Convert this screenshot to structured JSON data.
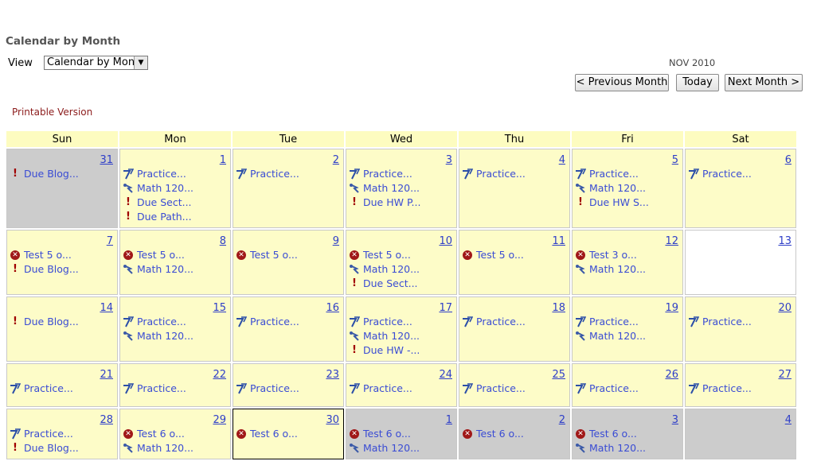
{
  "header": {
    "title": "Calendar by Month",
    "view_label": "View",
    "view_value": "Calendar by Month",
    "month_label": "NOV 2010",
    "prev_label": "< Previous Month",
    "today_label": "Today",
    "next_label": "Next Month >",
    "printable_label": "Printable Version"
  },
  "icons": {
    "due": "exclamation-icon",
    "practice": "pen-icon",
    "math": "pencil-icon",
    "test": "x-circle-icon"
  },
  "colors": {
    "cell_bg": "#fdfcc8",
    "other_month_bg": "#cccccc",
    "link": "#3a4cd4",
    "printable": "#8b1a1a"
  },
  "calendar": {
    "days": [
      "Sun",
      "Mon",
      "Tue",
      "Wed",
      "Thu",
      "Fri",
      "Sat"
    ],
    "weeks": [
      [
        {
          "day": "31",
          "other": true,
          "events": [
            {
              "type": "due",
              "label": "Due Blog..."
            }
          ]
        },
        {
          "day": "1",
          "events": [
            {
              "type": "practice",
              "label": "Practice..."
            },
            {
              "type": "math",
              "label": "Math 120..."
            },
            {
              "type": "due",
              "label": "Due Sect..."
            },
            {
              "type": "due",
              "label": "Due Path..."
            }
          ]
        },
        {
          "day": "2",
          "events": [
            {
              "type": "practice",
              "label": "Practice..."
            }
          ]
        },
        {
          "day": "3",
          "events": [
            {
              "type": "practice",
              "label": "Practice..."
            },
            {
              "type": "math",
              "label": "Math 120..."
            },
            {
              "type": "due",
              "label": "Due HW P..."
            }
          ]
        },
        {
          "day": "4",
          "events": [
            {
              "type": "practice",
              "label": "Practice..."
            }
          ]
        },
        {
          "day": "5",
          "events": [
            {
              "type": "practice",
              "label": "Practice..."
            },
            {
              "type": "math",
              "label": "Math 120..."
            },
            {
              "type": "due",
              "label": "Due HW S..."
            }
          ]
        },
        {
          "day": "6",
          "events": [
            {
              "type": "practice",
              "label": "Practice..."
            }
          ]
        }
      ],
      [
        {
          "day": "7",
          "events": [
            {
              "type": "test",
              "label": "Test 5 o..."
            },
            {
              "type": "due",
              "label": "Due Blog..."
            }
          ]
        },
        {
          "day": "8",
          "events": [
            {
              "type": "test",
              "label": "Test 5 o..."
            },
            {
              "type": "math",
              "label": "Math 120..."
            }
          ]
        },
        {
          "day": "9",
          "events": [
            {
              "type": "test",
              "label": "Test 5 o..."
            }
          ]
        },
        {
          "day": "10",
          "events": [
            {
              "type": "test",
              "label": "Test 5 o..."
            },
            {
              "type": "math",
              "label": "Math 120..."
            },
            {
              "type": "due",
              "label": "Due Sect..."
            }
          ]
        },
        {
          "day": "11",
          "events": [
            {
              "type": "test",
              "label": "Test 5 o..."
            }
          ]
        },
        {
          "day": "12",
          "events": [
            {
              "type": "test",
              "label": "Test 3 o..."
            },
            {
              "type": "math",
              "label": "Math 120..."
            }
          ]
        },
        {
          "day": "13",
          "white": true,
          "events": []
        }
      ],
      [
        {
          "day": "14",
          "events": [
            {
              "type": "due",
              "label": "Due Blog..."
            }
          ]
        },
        {
          "day": "15",
          "events": [
            {
              "type": "practice",
              "label": "Practice..."
            },
            {
              "type": "math",
              "label": "Math 120..."
            }
          ]
        },
        {
          "day": "16",
          "events": [
            {
              "type": "practice",
              "label": "Practice..."
            }
          ]
        },
        {
          "day": "17",
          "events": [
            {
              "type": "practice",
              "label": "Practice..."
            },
            {
              "type": "math",
              "label": "Math 120..."
            },
            {
              "type": "due",
              "label": "Due HW -..."
            }
          ]
        },
        {
          "day": "18",
          "events": [
            {
              "type": "practice",
              "label": "Practice..."
            }
          ]
        },
        {
          "day": "19",
          "events": [
            {
              "type": "practice",
              "label": "Practice..."
            },
            {
              "type": "math",
              "label": "Math 120..."
            }
          ]
        },
        {
          "day": "20",
          "events": [
            {
              "type": "practice",
              "label": "Practice..."
            }
          ]
        }
      ],
      [
        {
          "day": "21",
          "events": [
            {
              "type": "practice",
              "label": "Practice..."
            }
          ]
        },
        {
          "day": "22",
          "events": [
            {
              "type": "practice",
              "label": "Practice..."
            }
          ]
        },
        {
          "day": "23",
          "events": [
            {
              "type": "practice",
              "label": "Practice..."
            }
          ]
        },
        {
          "day": "24",
          "events": [
            {
              "type": "practice",
              "label": "Practice..."
            }
          ]
        },
        {
          "day": "25",
          "events": [
            {
              "type": "practice",
              "label": "Practice..."
            }
          ]
        },
        {
          "day": "26",
          "events": [
            {
              "type": "practice",
              "label": "Practice..."
            }
          ]
        },
        {
          "day": "27",
          "events": [
            {
              "type": "practice",
              "label": "Practice..."
            }
          ]
        }
      ],
      [
        {
          "day": "28",
          "events": [
            {
              "type": "practice",
              "label": "Practice..."
            },
            {
              "type": "due",
              "label": "Due Blog..."
            }
          ]
        },
        {
          "day": "29",
          "events": [
            {
              "type": "test",
              "label": "Test 6 o..."
            },
            {
              "type": "math",
              "label": "Math 120..."
            }
          ]
        },
        {
          "day": "30",
          "today": true,
          "events": [
            {
              "type": "test",
              "label": "Test 6 o..."
            }
          ]
        },
        {
          "day": "1",
          "other": true,
          "events": [
            {
              "type": "test",
              "label": "Test 6 o..."
            },
            {
              "type": "math",
              "label": "Math 120..."
            }
          ]
        },
        {
          "day": "2",
          "other": true,
          "events": [
            {
              "type": "test",
              "label": "Test 6 o..."
            }
          ]
        },
        {
          "day": "3",
          "other": true,
          "events": [
            {
              "type": "test",
              "label": "Test 6 o..."
            },
            {
              "type": "math",
              "label": "Math 120..."
            }
          ]
        },
        {
          "day": "4",
          "other": true,
          "events": []
        }
      ]
    ]
  }
}
